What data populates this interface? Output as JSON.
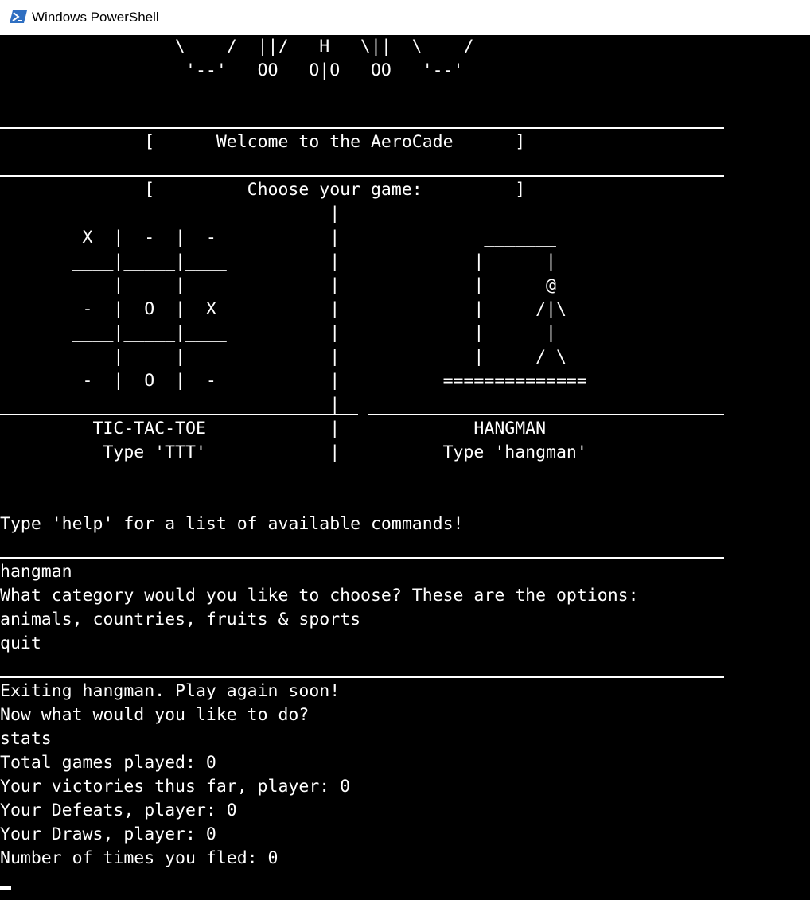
{
  "window": {
    "title": "Windows PowerShell",
    "icon": "powershell-icon",
    "colors": {
      "titlebar": "#ffffff",
      "console_bg": "#000000",
      "console_fg": "#ffffff",
      "icon": "#2f6fc2"
    }
  },
  "banner": {
    "art_line_1": "                 \\    /  ||/   H   \\||  \\    /",
    "art_line_2": "                  '--'   OO   O|O   OO   '--'",
    "welcome": "              [      Welcome to the AeroCade      ]",
    "choose": "              [         Choose your game:         ]"
  },
  "menu_art": {
    "lines": [
      "                                |",
      "        X  |  -  |  -           |              _______",
      "       ____|_____|____          |             |      |",
      "           |     |              |             |      @",
      "        -  |  O  |  X           |             |     /|\\",
      "       ____|_____|____          |             |      |",
      "           |     |              |             |     / \\",
      "        -  |  O  |  -           |          ==============",
      "                                |",
      "         TIC-TAC-TOE            |             HANGMAN",
      "          Type 'TTT'            |          Type 'hangman'"
    ]
  },
  "prompt_help": "Type 'help' for a list of available commands!",
  "session_1": {
    "lines": [
      "hangman",
      "What category would you like to choose? These are the options:",
      "animals, countries, fruits & sports",
      "quit"
    ]
  },
  "session_2": {
    "lines": [
      "Exiting hangman. Play again soon!",
      "Now what would you like to do?",
      "stats",
      "Total games played: 0",
      "Your victories thus far, player: 0",
      "Your Defeats, player: 0",
      "Your Draws, player: 0",
      "Number of times you fled: 0"
    ]
  }
}
